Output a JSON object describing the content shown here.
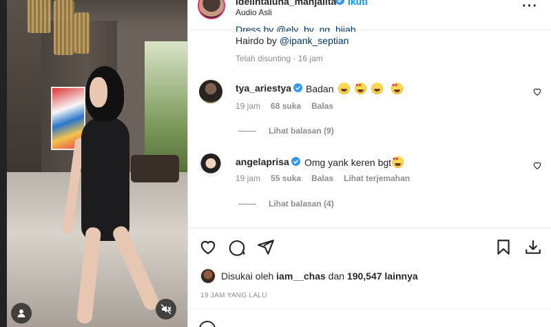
{
  "post": {
    "owner_username": "idelintaluna_manjalita",
    "follow_label": "Ikuti",
    "audio_label": "Audio Asli",
    "caption_partial": "Dress by @ely_by_ng_hijab",
    "caption_hairdo_prefix": "Hairdo by ",
    "caption_hairdo_mention": "@ipank_septian",
    "edited_label": "Telah disunting",
    "edited_time": "16 jam"
  },
  "comments": [
    {
      "username": "tya_ariestya",
      "text": "Badan",
      "emojis": [
        "laugh",
        "hearteyes",
        "laugh",
        "hearteyes"
      ],
      "time": "19 jam",
      "likes": "68 suka",
      "reply_label": "Balas",
      "translate_label": "",
      "view_replies": "Lihat balasan (9)"
    },
    {
      "username": "angelaprisa",
      "text": "Omg yank keren bgt",
      "emojis": [
        "hearteyes"
      ],
      "time": "19 jam",
      "likes": "55 suka",
      "reply_label": "Balas",
      "translate_label": "Lihat terjemahan",
      "view_replies": "Lihat balasan (4)"
    }
  ],
  "likes": {
    "prefix": "Disukai oleh",
    "user": "iam__chas",
    "connector": "dan",
    "count": "190,547 lainnya"
  },
  "time_ago": "19 JAM YANG LALU",
  "colors": {
    "link": "#00376b",
    "follow": "#0095f6",
    "verified": "#3897f0",
    "muted": "#8e8e8e"
  },
  "icons": [
    "user-avatar-icon",
    "mute-icon",
    "heart-icon",
    "comment-icon",
    "share-icon",
    "bookmark-icon",
    "download-icon",
    "more-icon",
    "verified-icon"
  ]
}
